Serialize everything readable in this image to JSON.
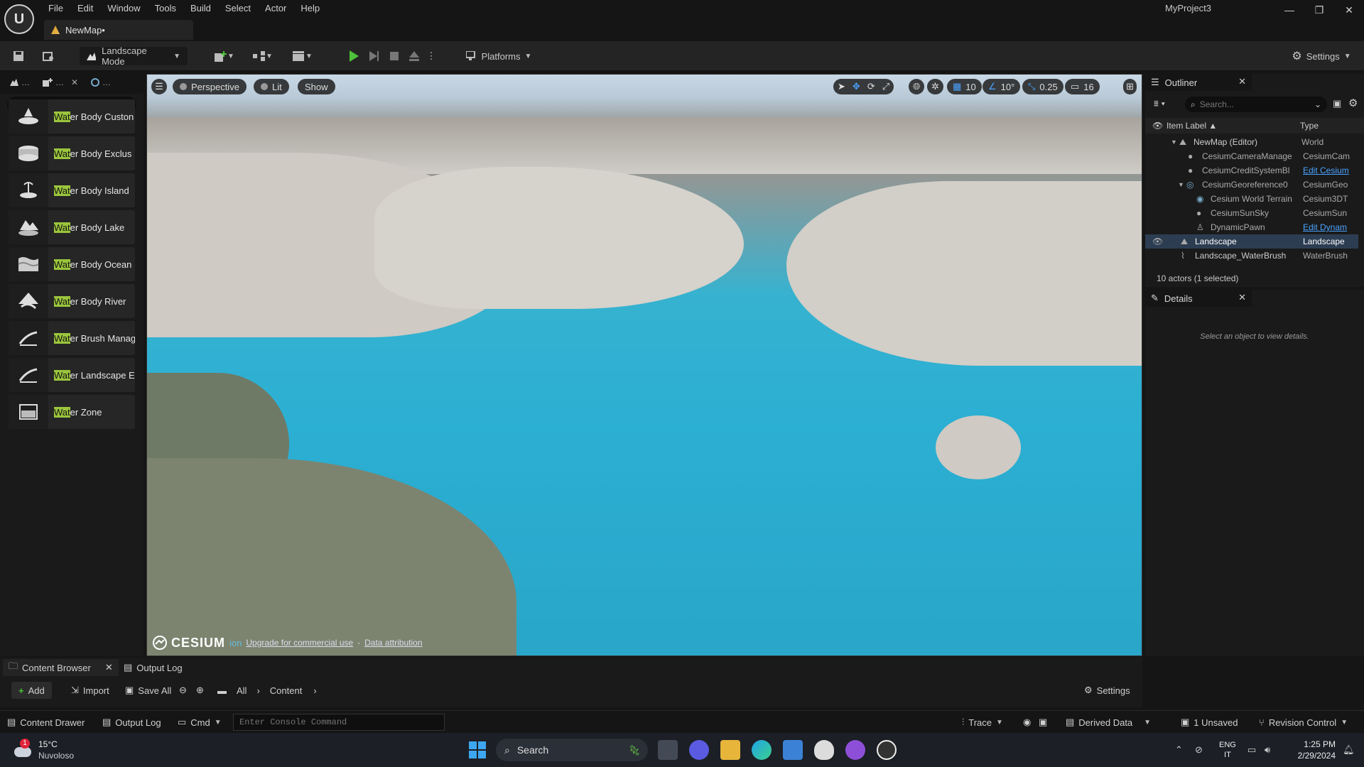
{
  "window": {
    "project_title": "MyProject3",
    "map_tab": "NewMap•",
    "menu": [
      "File",
      "Edit",
      "Window",
      "Tools",
      "Build",
      "Select",
      "Actor",
      "Help"
    ]
  },
  "toolbar": {
    "mode": "Landscape Mode",
    "platforms": "Platforms",
    "settings": "Settings"
  },
  "left_panel": {
    "search_value": "wat",
    "items": [
      {
        "highlight": "Wat",
        "rest": "er Body Custon"
      },
      {
        "highlight": "Wat",
        "rest": "er Body Exclus"
      },
      {
        "highlight": "Wat",
        "rest": "er Body Island"
      },
      {
        "highlight": "Wat",
        "rest": "er Body Lake"
      },
      {
        "highlight": "Wat",
        "rest": "er Body Ocean"
      },
      {
        "highlight": "Wat",
        "rest": "er Body River"
      },
      {
        "highlight": "Wat",
        "rest": "er Brush Manag"
      },
      {
        "highlight": "Wat",
        "rest": "er Landscape E"
      },
      {
        "highlight": "Wat",
        "rest": "er Zone"
      }
    ]
  },
  "viewport": {
    "perspective": "Perspective",
    "lit": "Lit",
    "show": "Show",
    "grid_snap": "10",
    "rot_snap": "10°",
    "scale_snap": "0.25",
    "camera_speed": "16",
    "cesium_logo": "CESIUM",
    "cesium_suffix": "ion",
    "upgrade_link": "Upgrade for commercial use",
    "attribution_link": "Data attribution"
  },
  "outliner": {
    "title": "Outliner",
    "search_placeholder": "Search...",
    "col_label": "Item Label ▲",
    "col_type": "Type",
    "rows": [
      {
        "label": "NewMap (Editor)",
        "type": "World"
      },
      {
        "label": "CesiumCameraManage",
        "type": "CesiumCam"
      },
      {
        "label": "CesiumCreditSystemBl",
        "type": "Edit Cesium"
      },
      {
        "label": "CesiumGeoreference0",
        "type": "CesiumGeo"
      },
      {
        "label": "Cesium World Terrain",
        "type": "Cesium3DT"
      },
      {
        "label": "CesiumSunSky",
        "type": "CesiumSun"
      },
      {
        "label": "DynamicPawn",
        "type": "Edit Dynam"
      },
      {
        "label": "Landscape",
        "type": "Landscape"
      },
      {
        "label": "Landscape_WaterBrush",
        "type": "WaterBrush"
      }
    ],
    "count": "10 actors (1 selected)"
  },
  "details": {
    "title": "Details",
    "empty": "Select an object to view details."
  },
  "content_browser": {
    "tab_cb": "Content Browser",
    "tab_log": "Output Log",
    "add": "Add",
    "import": "Import",
    "save_all": "Save All",
    "path_all": "All",
    "path_content": "Content",
    "settings": "Settings"
  },
  "statusbar": {
    "content_drawer": "Content Drawer",
    "output_log": "Output Log",
    "cmd": "Cmd",
    "console_placeholder": "Enter Console Command",
    "trace": "Trace",
    "derived_data": "Derived Data",
    "unsaved": "1 Unsaved",
    "revision": "Revision Control"
  },
  "taskbar": {
    "temp": "15°C",
    "weather": "Nuvoloso",
    "search": "Search",
    "lang1": "ENG",
    "lang2": "IT",
    "time": "1:25 PM",
    "date": "2/29/2024",
    "badge": "1"
  }
}
